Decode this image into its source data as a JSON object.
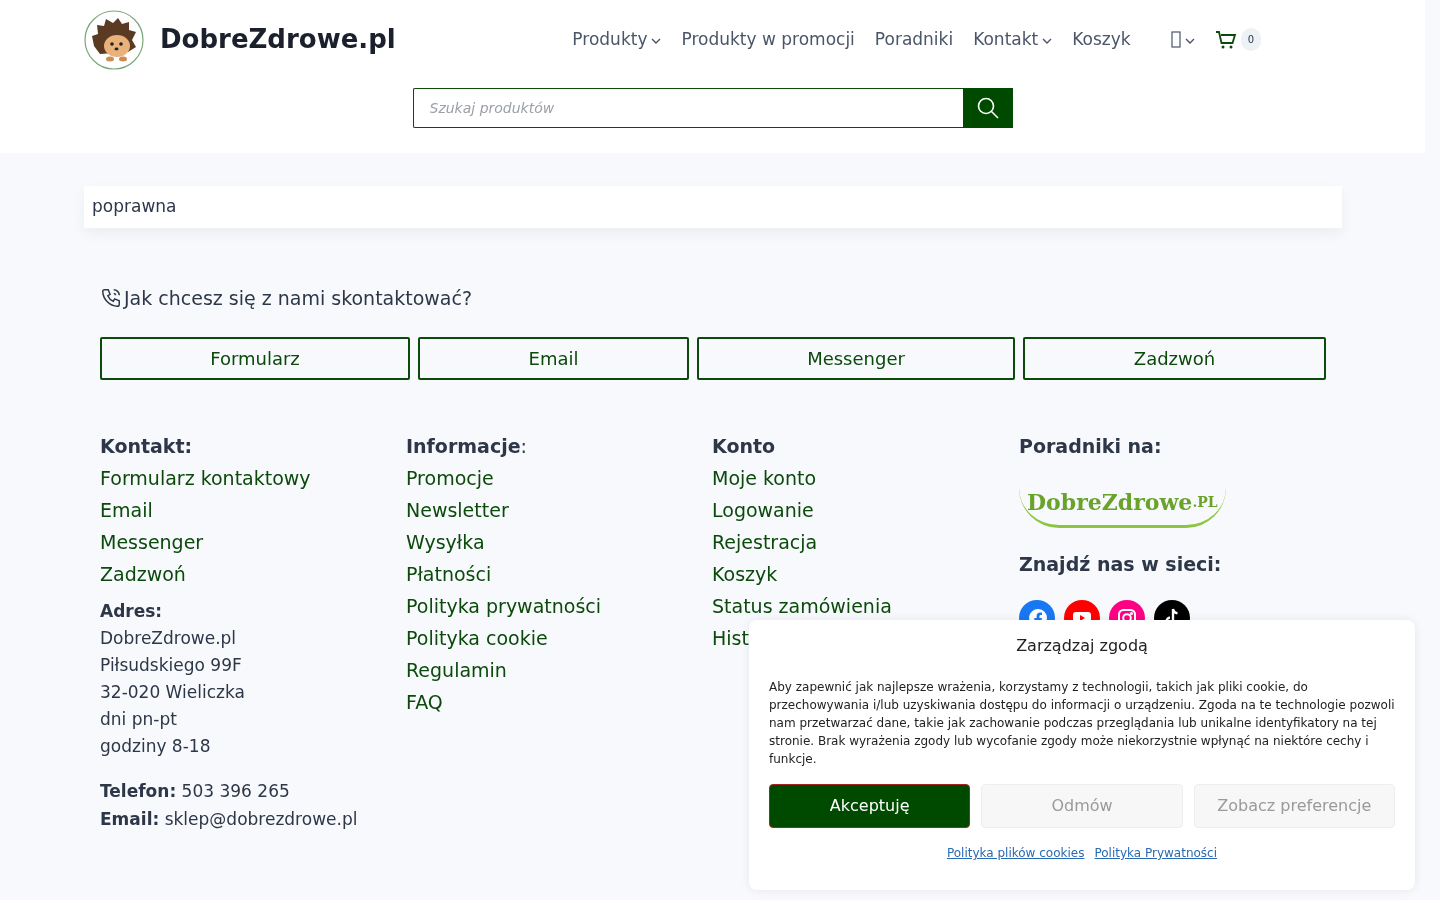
{
  "header": {
    "brand": "DobreZdrowe.pl",
    "nav": [
      {
        "label": "Produkty",
        "dropdown": true
      },
      {
        "label": "Produkty w promocji",
        "dropdown": false
      },
      {
        "label": "Poradniki",
        "dropdown": false
      },
      {
        "label": "Kontakt",
        "dropdown": true
      },
      {
        "label": "Koszyk",
        "dropdown": false
      }
    ],
    "cart_count": "0",
    "search": {
      "placeholder": "Szukaj produktów"
    }
  },
  "notice": "poprawna",
  "contact": {
    "question": "Jak chcesz się z nami skontaktować?",
    "buttons": [
      "Formularz",
      "Email",
      "Messenger",
      "Zadzwoń"
    ]
  },
  "footer": {
    "columns": [
      {
        "title": "Kontakt:",
        "links": [
          "Formularz kontaktowy",
          "Email",
          "Messenger",
          "Zadzwoń"
        ]
      },
      {
        "title": "Informacje",
        "suffix": ":",
        "links": [
          "Promocje",
          "Newsletter",
          "Wysyłka",
          "Płatności",
          "Polityka prywatności",
          "Polityka cookie",
          "Regulamin",
          "FAQ"
        ]
      },
      {
        "title": "Konto",
        "links": [
          "Moje konto",
          "Logowanie",
          "Rejestracja",
          "Koszyk",
          "Status zamówienia",
          "Hist"
        ]
      }
    ],
    "address": {
      "title": "Adres:",
      "lines": [
        "DobreZdrowe.pl",
        "Piłsudskiego 99F",
        "32-020 Wieliczka",
        "dni pn-pt",
        "godziny 8-18"
      ]
    },
    "phone": {
      "label": "Telefon:",
      "value": "503 396 265"
    },
    "email": {
      "label": "Email:",
      "value": "sklep@dobrezdrowe.pl"
    },
    "guides": {
      "title": "Poradniki na:",
      "logo_text": "DobreZdrowe",
      "logo_suffix": ".PL"
    },
    "social": {
      "title": "Znajdź nas w sieci:",
      "networks": [
        {
          "kind": "facebook",
          "color": "#1877f2"
        },
        {
          "kind": "youtube",
          "color": "#ff0000"
        },
        {
          "kind": "instagram",
          "color": "#ff0084"
        },
        {
          "kind": "tiktok",
          "color": "#000000"
        }
      ]
    }
  },
  "consent": {
    "title": "Zarządzaj zgodą",
    "text": "Aby zapewnić jak najlepsze wrażenia, korzystamy z technologii, takich jak pliki cookie, do przechowywania i/lub uzyskiwania dostępu do informacji o urządzeniu. Zgoda na te technologie pozwoli nam przetwarzać dane, takie jak zachowanie podczas przeglądania lub unikalne identyfikatory na tej stronie. Brak wyrażenia zgody lub wycofanie zgody może niekorzystnie wpłynąć na niektóre cechy i funkcje.",
    "buttons": [
      {
        "label": "Akceptuję",
        "kind": "primary"
      },
      {
        "label": "Odmów",
        "kind": "secondary"
      },
      {
        "label": "Zobacz preferencje",
        "kind": "secondary"
      }
    ],
    "links": [
      "Polityka plików cookies",
      "Polityka Prywatności"
    ]
  }
}
